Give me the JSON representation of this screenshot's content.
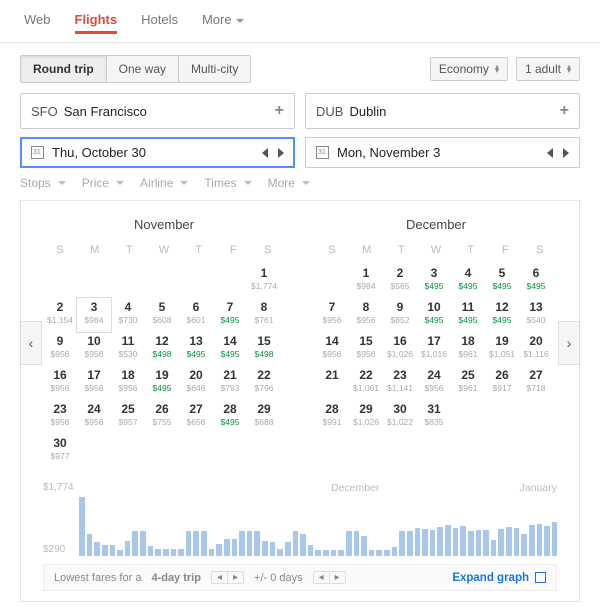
{
  "nav": {
    "web": "Web",
    "flights": "Flights",
    "hotels": "Hotels",
    "more": "More"
  },
  "trip": {
    "round": "Round trip",
    "oneway": "One way",
    "multi": "Multi-city"
  },
  "passengers": {
    "cabin": "Economy",
    "count": "1 adult"
  },
  "origin": {
    "code": "SFO",
    "city": "San Francisco"
  },
  "dest": {
    "code": "DUB",
    "city": "Dublin"
  },
  "dates": {
    "depart": "Thu, October 30",
    "ret": "Mon, November 3"
  },
  "filters": {
    "stops": "Stops",
    "price": "Price",
    "airline": "Airline",
    "times": "Times",
    "more": "More"
  },
  "cal": {
    "weekdays": [
      "S",
      "M",
      "T",
      "W",
      "T",
      "F",
      "S"
    ],
    "months": [
      {
        "name": "November",
        "offset": 6,
        "days": [
          {
            "d": 1,
            "p": "$1,774"
          },
          {
            "d": 2,
            "p": "$1,154"
          },
          {
            "d": 3,
            "p": "$984",
            "today": true
          },
          {
            "d": 4,
            "p": "$730"
          },
          {
            "d": 5,
            "p": "$608"
          },
          {
            "d": 6,
            "p": "$601"
          },
          {
            "d": 7,
            "p": "$495",
            "g": true
          },
          {
            "d": 8,
            "p": "$761"
          },
          {
            "d": 9,
            "p": "$956"
          },
          {
            "d": 10,
            "p": "$956"
          },
          {
            "d": 11,
            "p": "$530"
          },
          {
            "d": 12,
            "p": "$498",
            "g": true
          },
          {
            "d": 13,
            "p": "$495",
            "g": true
          },
          {
            "d": 14,
            "p": "$495",
            "g": true
          },
          {
            "d": 15,
            "p": "$498",
            "g": true
          },
          {
            "d": 16,
            "p": "$956"
          },
          {
            "d": 17,
            "p": "$956"
          },
          {
            "d": 18,
            "p": "$956"
          },
          {
            "d": 19,
            "p": "$495",
            "g": true
          },
          {
            "d": 20,
            "p": "$646"
          },
          {
            "d": 21,
            "p": "$793"
          },
          {
            "d": 22,
            "p": "$796"
          },
          {
            "d": 23,
            "p": "$956"
          },
          {
            "d": 24,
            "p": "$956"
          },
          {
            "d": 25,
            "p": "$957"
          },
          {
            "d": 26,
            "p": "$755"
          },
          {
            "d": 27,
            "p": "$656"
          },
          {
            "d": 28,
            "p": "$495",
            "g": true
          },
          {
            "d": 29,
            "p": "$688"
          },
          {
            "d": 30,
            "p": "$977"
          }
        ]
      },
      {
        "name": "December",
        "offset": 1,
        "days": [
          {
            "d": 1,
            "p": "$984"
          },
          {
            "d": 2,
            "p": "$565"
          },
          {
            "d": 3,
            "p": "$495",
            "g": true
          },
          {
            "d": 4,
            "p": "$495",
            "g": true
          },
          {
            "d": 5,
            "p": "$495",
            "g": true
          },
          {
            "d": 6,
            "p": "$495",
            "g": true
          },
          {
            "d": 7,
            "p": "$956"
          },
          {
            "d": 8,
            "p": "$956"
          },
          {
            "d": 9,
            "p": "$852"
          },
          {
            "d": 10,
            "p": "$495",
            "g": true
          },
          {
            "d": 11,
            "p": "$495",
            "g": true
          },
          {
            "d": 12,
            "p": "$495",
            "g": true
          },
          {
            "d": 13,
            "p": "$540"
          },
          {
            "d": 14,
            "p": "$956"
          },
          {
            "d": 15,
            "p": "$956"
          },
          {
            "d": 16,
            "p": "$1,026"
          },
          {
            "d": 17,
            "p": "$1,016"
          },
          {
            "d": 18,
            "p": "$961"
          },
          {
            "d": 19,
            "p": "$1,051"
          },
          {
            "d": 20,
            "p": "$1,116"
          },
          {
            "d": 21
          },
          {
            "d": 22,
            "p": "$1,061"
          },
          {
            "d": 23,
            "p": "$1,141"
          },
          {
            "d": 24,
            "p": "$956"
          },
          {
            "d": 25,
            "p": "$961"
          },
          {
            "d": 26,
            "p": "$917"
          },
          {
            "d": 27,
            "p": "$718"
          },
          {
            "d": 28,
            "p": "$991"
          },
          {
            "d": 29,
            "p": "$1,026"
          },
          {
            "d": 30,
            "p": "$1,022"
          },
          {
            "d": 31,
            "p": "$835"
          }
        ]
      }
    ]
  },
  "graph": {
    "high": "$1,774",
    "low": "$290",
    "m1": "December",
    "m2": "January",
    "bars": [
      95,
      35,
      22,
      18,
      18,
      10,
      25,
      40,
      40,
      16,
      12,
      12,
      12,
      12,
      40,
      40,
      40,
      12,
      20,
      28,
      28,
      40,
      40,
      40,
      25,
      22,
      12,
      22,
      40,
      36,
      18,
      10,
      10,
      10,
      10,
      40,
      40,
      32,
      10,
      10,
      10,
      15,
      40,
      40,
      45,
      44,
      42,
      46,
      50,
      45,
      48,
      40,
      42,
      42,
      26,
      44,
      46,
      45,
      35,
      50,
      52,
      48,
      55
    ]
  },
  "footer": {
    "text1": "Lowest fares for a",
    "bold": "4-day trip",
    "text2": "+/- 0 days",
    "expand": "Expand graph"
  }
}
